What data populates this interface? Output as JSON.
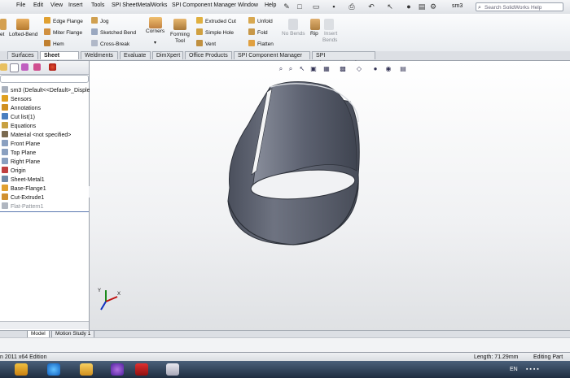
{
  "menubar": {
    "items": [
      "File",
      "Edit",
      "View",
      "Insert",
      "Tools",
      "SPI SheetMetalWorks",
      "SPI Component Manager",
      "Window",
      "Help"
    ],
    "doc_title": "sm3",
    "search_placeholder": "Search SolidWorks Help"
  },
  "ribbon": {
    "partial_left": [
      "et",
      "Lofted-Bend"
    ],
    "col1": [
      "Edge Flange",
      "Miter Flange",
      "Hem"
    ],
    "col2": [
      "Jog",
      "Sketched Bend",
      "Cross-Break"
    ],
    "corners": "Corners",
    "forming_tool": [
      "Forming",
      "Tool"
    ],
    "col3": [
      "Extruded Cut",
      "Simple Hole",
      "Vent"
    ],
    "col4": [
      "Unfold",
      "Fold",
      "Flatten"
    ],
    "no_bends": "No Bends",
    "rip": "Rip",
    "insert_bends": [
      "Insert",
      "Bends"
    ]
  },
  "tabs": [
    "Surfaces",
    "Sheet Metal",
    "Weldments",
    "Evaluate",
    "DimXpert",
    "Office Products",
    "SPI Component Manager",
    "SPI SheetMetalWorks"
  ],
  "active_tab": "Sheet Metal",
  "tree": {
    "root": "sm3  (Default<<Default>_Disple",
    "items": [
      {
        "label": "Sensors",
        "color": "#e0a020"
      },
      {
        "label": "Annotations",
        "color": "#d09020"
      },
      {
        "label": "Cut list(1)",
        "color": "#4a7fc0"
      },
      {
        "label": "Equations",
        "color": "#c8a040"
      },
      {
        "label": "Material <not specified>",
        "color": "#7a6a50"
      },
      {
        "label": "Front Plane",
        "color": "#8aa0c0"
      },
      {
        "label": "Top Plane",
        "color": "#8aa0c0"
      },
      {
        "label": "Right Plane",
        "color": "#8aa0c0"
      },
      {
        "label": "Origin",
        "color": "#c04040"
      },
      {
        "label": "Sheet-Metal1",
        "color": "#708aa8"
      },
      {
        "label": "Base-Flange1",
        "color": "#e0a030"
      },
      {
        "label": "Cut-Extrude1",
        "color": "#d09030"
      },
      {
        "label": "Flat-Pattern1",
        "color": "#b0b6c0"
      }
    ]
  },
  "model_tabs": [
    "Model",
    "Motion Study 1"
  ],
  "status": {
    "left": "n 2011 x64 Edition",
    "length": "Length: 71.29mm",
    "mode": "Editing Part"
  },
  "taskbar": {
    "lang": "EN"
  },
  "colors": {
    "active_tab_bg": "#ffffff",
    "model_shade": "#5d6270"
  }
}
